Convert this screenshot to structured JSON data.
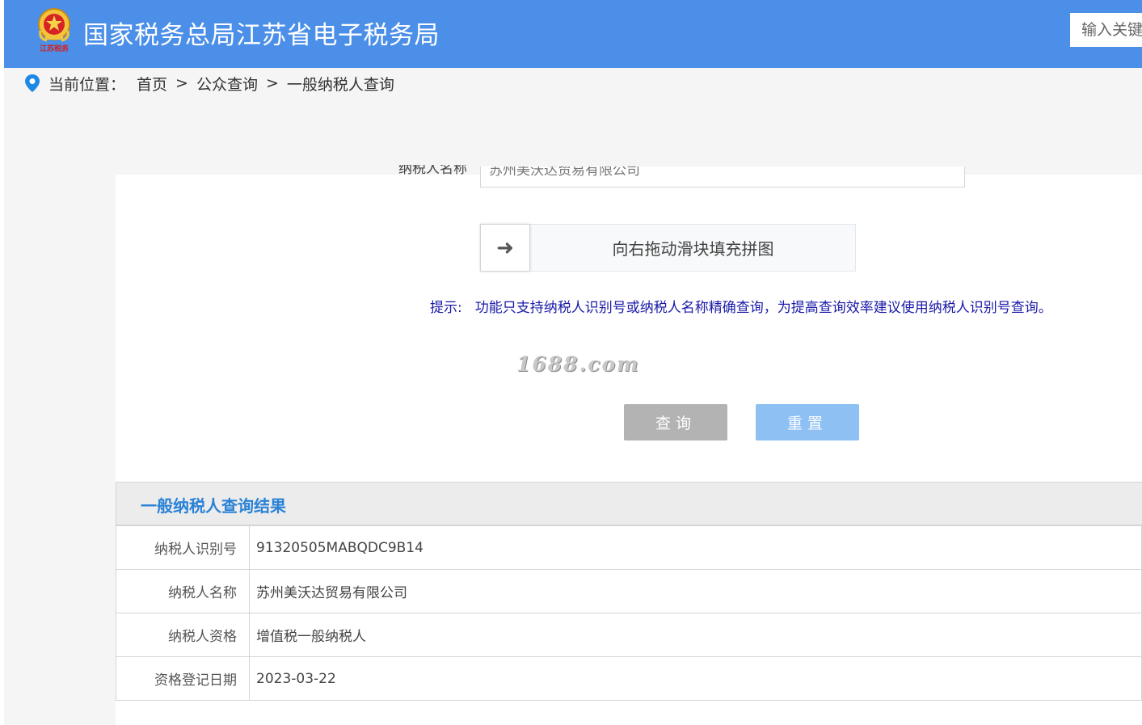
{
  "header": {
    "site_title": "国家税务总局江苏省电子税务局",
    "emblem_caption": "江苏税务",
    "search_placeholder": "输入关键",
    "bg_color": "#4b8fe8"
  },
  "breadcrumb": {
    "prefix": "当前位置：",
    "items": [
      "首页",
      "公众查询",
      "一般纳税人查询"
    ],
    "separator": ">"
  },
  "form": {
    "partial_label": "纳税人名称",
    "partial_value": "苏州美沃达贸易有限公司",
    "slider_text": "向右拖动滑块填充拼图",
    "slider_icon": "arrow-right-icon",
    "hint_label": "提示:",
    "hint_text": "功能只支持纳税人识别号或纳税人名称精确查询，为提高查询效率建议使用纳税人识别号查询。",
    "watermark": "1688.com",
    "query_button": "查询",
    "reset_button": "重置"
  },
  "results": {
    "title": "一般纳税人查询结果",
    "rows": [
      {
        "key": "纳税人识别号",
        "value": "91320505MABQDC9B14"
      },
      {
        "key": "纳税人名称",
        "value": "苏州美沃达贸易有限公司"
      },
      {
        "key": "纳税人资格",
        "value": "增值税一般纳税人"
      },
      {
        "key": "资格登记日期",
        "value": "2023-03-22"
      }
    ]
  }
}
